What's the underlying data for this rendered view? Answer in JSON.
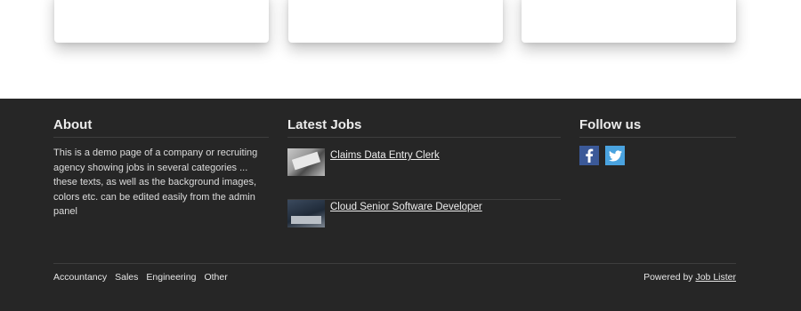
{
  "about": {
    "title": "About",
    "text": "This is a demo page of a company or recruiting agency showing jobs in several categories ... these texts, as well as the background images, colors etc. can be edited easily from the admin panel"
  },
  "latest_jobs": {
    "title": "Latest Jobs",
    "items": [
      {
        "title": "Claims Data Entry Clerk",
        "thumb_icon": "keyboard-photo"
      },
      {
        "title": "Cloud Senior Software Developer",
        "thumb_icon": "laptop-photo"
      }
    ]
  },
  "follow": {
    "title": "Follow us",
    "icons": [
      "facebook-icon",
      "twitter-icon"
    ]
  },
  "categories": [
    "Accountancy",
    "Sales",
    "Engineering",
    "Other"
  ],
  "powered": {
    "prefix": "Powered by ",
    "link": "Job Lister"
  },
  "colors": {
    "footer_bg": "#262626",
    "facebook": "#3b5998",
    "twitter": "#4aa3df"
  }
}
